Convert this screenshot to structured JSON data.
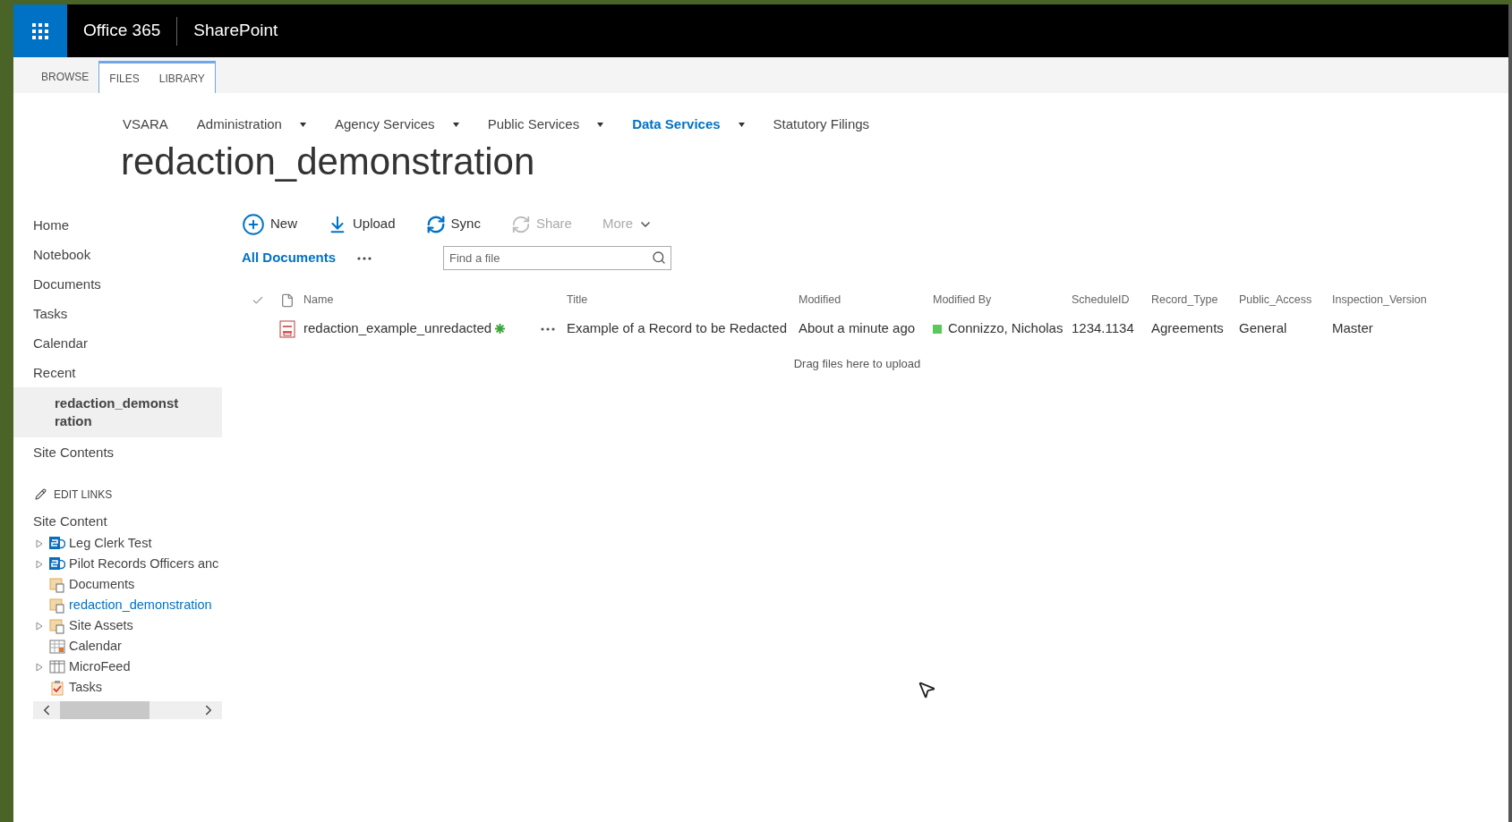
{
  "suite_bar": {
    "app": "Office 365",
    "site": "SharePoint"
  },
  "ribbon_tabs": [
    {
      "label": "BROWSE",
      "kind": "plain",
      "selected": false
    },
    {
      "label": "FILES",
      "kind": "contextual",
      "selected": false
    },
    {
      "label": "LIBRARY",
      "kind": "contextual",
      "selected": false
    }
  ],
  "top_nav": [
    {
      "label": "VSARA",
      "has_menu": false,
      "selected": false
    },
    {
      "label": "Administration",
      "has_menu": true,
      "selected": false
    },
    {
      "label": "Agency Services",
      "has_menu": true,
      "selected": false
    },
    {
      "label": "Public Services",
      "has_menu": true,
      "selected": false
    },
    {
      "label": "Data Services",
      "has_menu": true,
      "selected": true
    },
    {
      "label": "Statutory Filings",
      "has_menu": false,
      "selected": false
    }
  ],
  "page_title": "redaction_demonstration",
  "quick_launch": [
    {
      "label": "Home",
      "selected": false
    },
    {
      "label": "Notebook",
      "selected": false
    },
    {
      "label": "Documents",
      "selected": false
    },
    {
      "label": "Tasks",
      "selected": false
    },
    {
      "label": "Calendar",
      "selected": false
    },
    {
      "label": "Recent",
      "selected": false,
      "children": [
        {
          "label": "redaction_demonstration",
          "selected": true
        }
      ]
    },
    {
      "label": "Site Contents",
      "selected": false
    }
  ],
  "edit_links": "EDIT LINKS",
  "site_content": {
    "label": "Site Content",
    "items": [
      {
        "label": "Leg Clerk Test",
        "kind": "site",
        "expandable": true,
        "selected": false
      },
      {
        "label": "Pilot Records Officers anc",
        "kind": "site",
        "expandable": true,
        "selected": false
      },
      {
        "label": "Documents",
        "kind": "library",
        "expandable": false,
        "selected": false
      },
      {
        "label": "redaction_demonstration",
        "kind": "library",
        "expandable": false,
        "selected": true
      },
      {
        "label": "Site Assets",
        "kind": "library",
        "expandable": true,
        "selected": false
      },
      {
        "label": "Calendar",
        "kind": "calendar",
        "expandable": false,
        "selected": false
      },
      {
        "label": "MicroFeed",
        "kind": "list",
        "expandable": true,
        "selected": false
      },
      {
        "label": "Tasks",
        "kind": "tasks",
        "expandable": false,
        "selected": false
      }
    ]
  },
  "toolbar": [
    {
      "label": "New",
      "kind": "new",
      "disabled": false
    },
    {
      "label": "Upload",
      "kind": "upload",
      "disabled": false
    },
    {
      "label": "Sync",
      "kind": "sync",
      "disabled": false
    },
    {
      "label": "Share",
      "kind": "share",
      "disabled": true
    },
    {
      "label": "More",
      "kind": "more",
      "disabled": true
    }
  ],
  "view": {
    "label": "All Documents"
  },
  "search": {
    "placeholder": "Find a file"
  },
  "table": {
    "columns": [
      "Name",
      "Title",
      "Modified",
      "Modified By",
      "ScheduleID",
      "Record_Type",
      "Public_Access",
      "Inspection_Version"
    ],
    "rows": [
      {
        "name": "redaction_example_unredacted",
        "new": true,
        "title": "Example of a Record to be Redacted",
        "modified": "About a minute ago",
        "modified_by": "Connizzo, Nicholas",
        "color": "#5ac85a",
        "schedule_id": "1234.1134",
        "record_type": "Agreements",
        "public_access": "General",
        "inspection_version": "Master"
      }
    ]
  },
  "drop_hint": "Drag files here to upload"
}
